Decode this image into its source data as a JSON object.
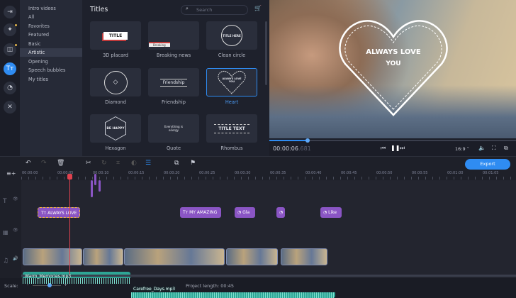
{
  "sidebar": {
    "icons": [
      "import-icon",
      "magic-wand-icon",
      "transitions-icon",
      "titles-icon",
      "stickers-icon",
      "tools-icon"
    ],
    "active": "titles-icon"
  },
  "categories": {
    "items": [
      "Intro videos",
      "All",
      "Favorites",
      "Featured",
      "Basic",
      "Artistic",
      "Opening",
      "Speech bubbles",
      "My titles"
    ],
    "selected": "Artistic"
  },
  "titles_panel": {
    "heading": "Titles",
    "search_placeholder": "Search",
    "items": [
      {
        "label": "3D placard",
        "preview": "TITLE"
      },
      {
        "label": "Breaking news",
        "preview": "Breaking"
      },
      {
        "label": "Clean circle",
        "preview": "TITLE HERE"
      },
      {
        "label": "Diamond",
        "preview": "◇"
      },
      {
        "label": "Friendship",
        "preview": "Friendship"
      },
      {
        "label": "Heart",
        "preview": "ALWAYS LOVE YOU"
      },
      {
        "label": "Hexagon",
        "preview": "BE HAPPY"
      },
      {
        "label": "Quote",
        "preview": "Everything is energy"
      },
      {
        "label": "Rhombus",
        "preview": "TITLE TEXT"
      }
    ],
    "selected": "Heart"
  },
  "preview": {
    "overlay_line1": "ALWAYS LOVE",
    "overlay_line2": "YOU",
    "progress": 0.155
  },
  "player": {
    "time": "00:00:06",
    "time_ms": ".681",
    "aspect": "16:9 ˅"
  },
  "toolbar": {
    "export_label": "Export"
  },
  "ruler": [
    "00:00:00",
    "00:00:05",
    "00:00:10",
    "00:00:15",
    "00:00:20",
    "00:00:25",
    "00:00:30",
    "00:00:35",
    "00:00:40",
    "00:00:45",
    "00:00:50",
    "00:00:55",
    "00:01:00",
    "00:01:05"
  ],
  "title_clips": [
    "ALWAYS LOVE",
    "MY AMAZING",
    "Gla",
    "",
    "Like"
  ],
  "audio_clips": [
    "Warm_Memories.mp3",
    "Carefree_Days.mp3"
  ],
  "footer": {
    "scale_label": "Scale:",
    "project_length_label": "Project length:",
    "project_length": "00:45",
    "scale_value": 0.6
  },
  "colors": {
    "accent": "#2f8cf2",
    "title_clip": "#8a55c4",
    "audio_clip": "#2ea595",
    "playhead": "#e0424f"
  }
}
